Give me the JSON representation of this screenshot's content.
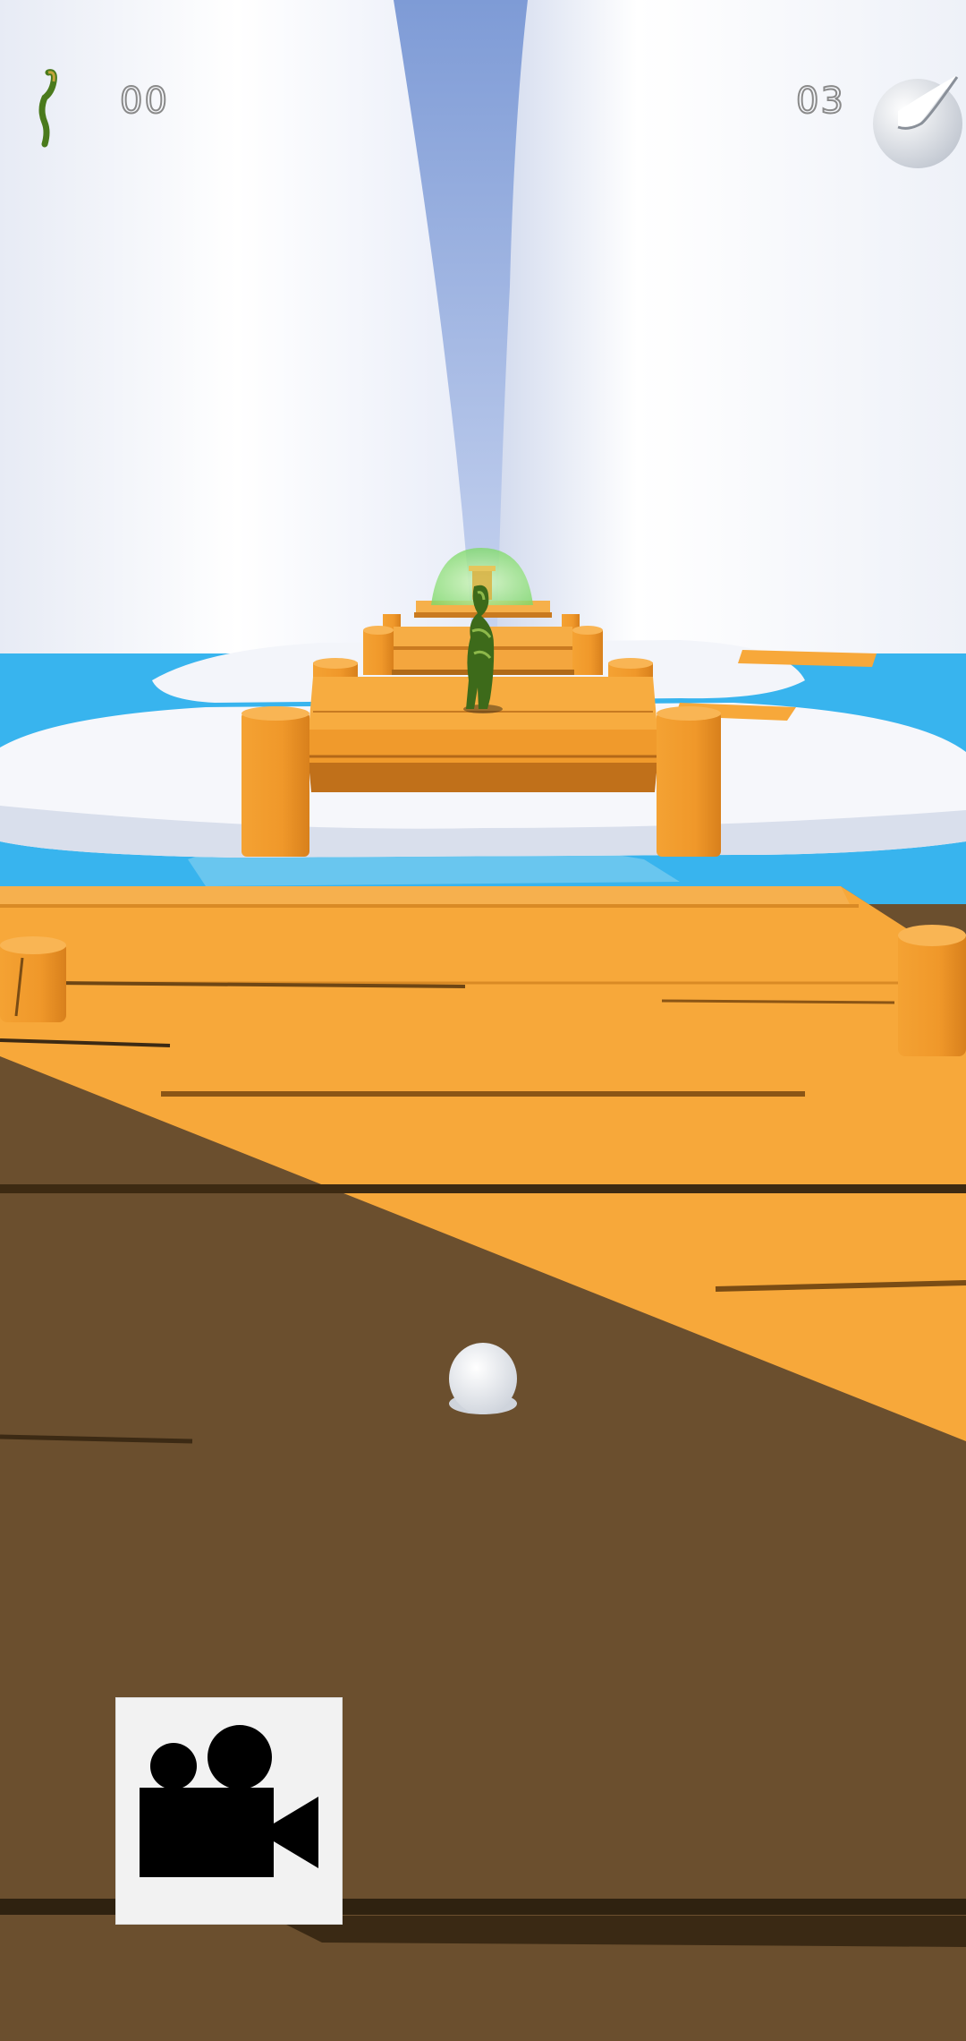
{
  "hud": {
    "snake_count": "00",
    "ball_count": "03",
    "snake_icon": "snake-icon",
    "ball_icon": "ball-icon"
  },
  "controls": {
    "camera_button_icon": "video-camera-icon"
  },
  "colors": {
    "sky": "#7e9bd6",
    "glacier": "#f4f6fb",
    "water": "#38b4ee",
    "plank_light": "#f7a83a",
    "plank_shadow": "#6b4f2e",
    "post": "#f09a2c",
    "character": "#3d6a1a",
    "goal_dome": "#8fe07a"
  }
}
